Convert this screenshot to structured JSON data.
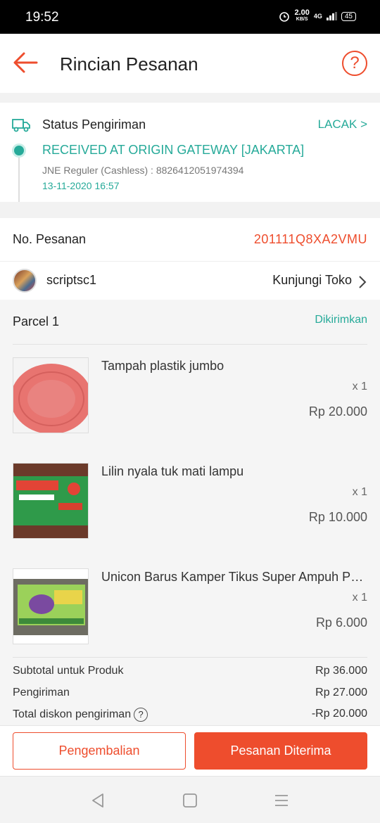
{
  "status_bar": {
    "time": "19:52",
    "net_speed": "2.00",
    "net_unit": "KB/S",
    "network": "4G",
    "battery": "45"
  },
  "header": {
    "title": "Rincian Pesanan",
    "back_icon": "arrow-left-icon",
    "help_icon": "question-circle-icon"
  },
  "shipping": {
    "label": "Status Pengiriman",
    "track_label": "LACAK >",
    "status": "RECEIVED AT ORIGIN GATEWAY [JAKARTA]",
    "courier": "JNE Reguler (Cashless) :  8826412051974394",
    "datetime": "13-11-2020 16:57"
  },
  "order": {
    "label": "No. Pesanan",
    "number": "201111Q8XA2VMU"
  },
  "shop": {
    "name": "scriptsc1",
    "visit_label": "Kunjungi Toko"
  },
  "parcel": {
    "title": "Parcel 1",
    "status": "Dikirimkan",
    "items": [
      {
        "name": "Tampah plastik jumbo",
        "qty": "x 1",
        "price": "Rp 20.000"
      },
      {
        "name": "Lilin nyala tuk mati lampu",
        "qty": "x 1",
        "price": "Rp 10.000"
      },
      {
        "name": "Unicon Barus Kamper Tikus Super Ampuh Pembasmi Tikus",
        "qty": "x 1",
        "price": "Rp 6.000"
      }
    ]
  },
  "summary": {
    "subtotal_label": "Subtotal untuk Produk",
    "subtotal_value": "Rp 36.000",
    "shipping_label": "Pengiriman",
    "shipping_value": "Rp 27.000",
    "discount_label": "Total diskon pengiriman",
    "discount_value": "-Rp 20.000"
  },
  "actions": {
    "return_label": "Pengembalian",
    "received_label": "Pesanan Diterima"
  },
  "colors": {
    "accent": "#ee4d2d",
    "teal": "#26aa99"
  }
}
